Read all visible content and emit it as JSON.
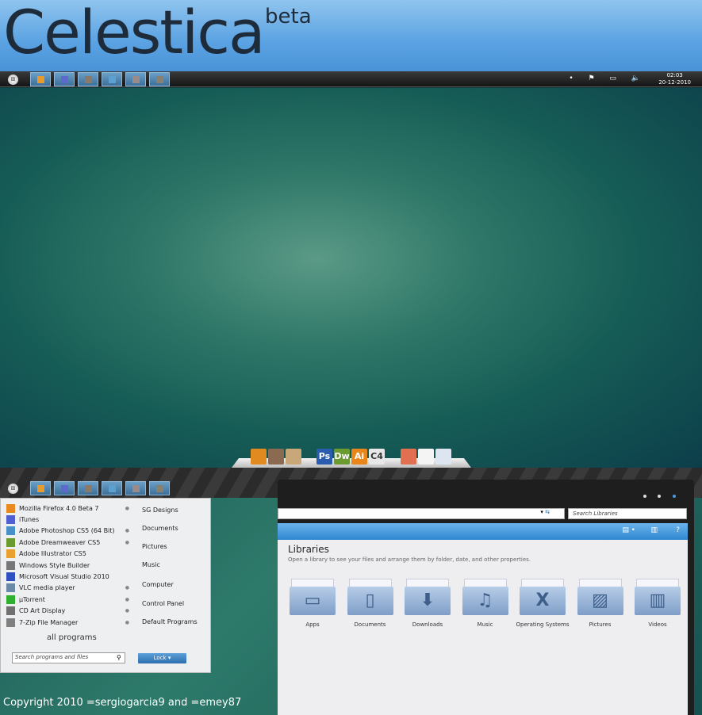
{
  "header": {
    "title": "Celestica",
    "badge": "beta"
  },
  "taskbar": {
    "clock_time": "02:03",
    "clock_date": "20-12-2010",
    "tray_icons": [
      "dot-icon",
      "flag-icon",
      "network-icon",
      "volume-icon"
    ],
    "buttons": [
      {
        "icon": "firefox-icon",
        "color": "#e89a2c"
      },
      {
        "icon": "itunes-icon",
        "color": "#5c6ad0"
      },
      {
        "icon": "app-icon",
        "color": "#8a7a6a"
      },
      {
        "icon": "photoshop-icon",
        "color": "#5aa0d0"
      },
      {
        "icon": "app-icon",
        "color": "#9a8a8a"
      },
      {
        "icon": "app-icon",
        "color": "#8a8070"
      }
    ]
  },
  "dock": {
    "icons": [
      {
        "name": "app-icon",
        "text": "",
        "color": "#e08a20"
      },
      {
        "name": "speaker-icon",
        "text": "",
        "color": "#8a6a50"
      },
      {
        "name": "package-icon",
        "text": "",
        "color": "#c8a878"
      },
      {
        "name": "photoshop-icon",
        "text": "Ps",
        "color": "#2a5cb0"
      },
      {
        "name": "dreamweaver-icon",
        "text": "Dw",
        "color": "#6a9a30"
      },
      {
        "name": "illustrator-icon",
        "text": "Ai",
        "color": "#e8861c"
      },
      {
        "name": "cinema4d-icon",
        "text": "C4",
        "color": "#e8e8e8"
      },
      {
        "name": "photos-icon",
        "text": "",
        "color": "#e07050"
      },
      {
        "name": "blank-icon",
        "text": "",
        "color": "#f4f4f4"
      },
      {
        "name": "document-icon",
        "text": "",
        "color": "#dde6f0"
      }
    ]
  },
  "start_menu": {
    "programs": [
      {
        "label": "Mozilla Firefox 4.0 Beta 7",
        "color": "#e88a20",
        "arrow": true
      },
      {
        "label": "iTunes",
        "color": "#5060d0",
        "arrow": false
      },
      {
        "label": "Adobe Photoshop CS5 (64 Bit)",
        "color": "#4a90c8",
        "arrow": true
      },
      {
        "label": "Adobe Dreamweaver CS5",
        "color": "#6a9a30",
        "arrow": true
      },
      {
        "label": "Adobe Illustrator CS5",
        "color": "#e8a030",
        "arrow": false
      },
      {
        "label": "Windows Style Builder",
        "color": "#777777",
        "arrow": false
      },
      {
        "label": "Microsoft Visual Studio 2010",
        "color": "#3050c0",
        "arrow": false
      },
      {
        "label": "VLC media player",
        "color": "#6a8aa8",
        "arrow": true
      },
      {
        "label": "µTorrent",
        "color": "#30b030",
        "arrow": true
      },
      {
        "label": "CD Art Display",
        "color": "#707070",
        "arrow": true
      },
      {
        "label": "7-Zip File Manager",
        "color": "#808080",
        "arrow": true
      }
    ],
    "places": [
      "SG Designs",
      "Documents",
      "Pictures",
      "Music",
      "Computer",
      "Control Panel",
      "Default Programs"
    ],
    "all_programs": "all programs",
    "search_placeholder": "Search programs and files",
    "lock_label": "Lock"
  },
  "explorer": {
    "search_placeholder": "Search Libraries",
    "title": "Libraries",
    "subtitle": "Open a library to see your files and arrange them by folder, date, and other properties.",
    "libraries": [
      {
        "label": "Apps",
        "glyph": "▭"
      },
      {
        "label": "Documents",
        "glyph": "▯"
      },
      {
        "label": "Downloads",
        "glyph": "⬇"
      },
      {
        "label": "Music",
        "glyph": "♫"
      },
      {
        "label": "Operating Systems",
        "glyph": "X"
      },
      {
        "label": "Pictures",
        "glyph": "▨"
      },
      {
        "label": "Videos",
        "glyph": "▥"
      }
    ]
  },
  "copyright": "Copyright 2010 =sergiogarcia9 and =emey87"
}
